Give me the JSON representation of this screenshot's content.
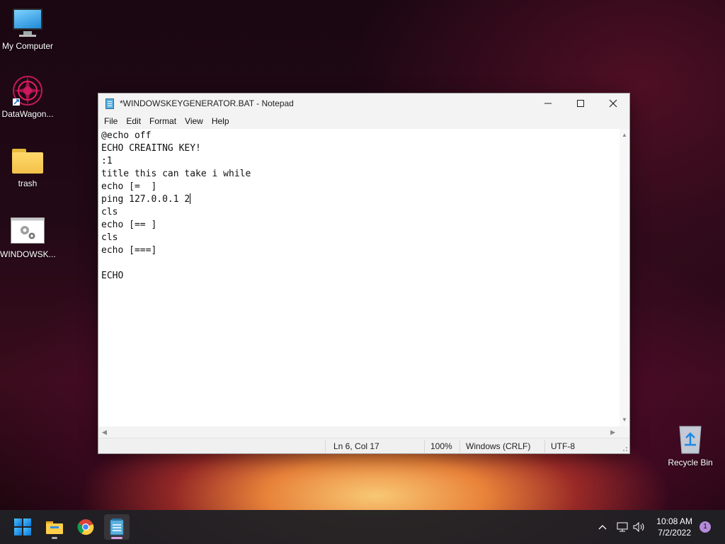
{
  "desktop": {
    "icons": [
      {
        "label": "My Computer",
        "icon": "computer-icon"
      },
      {
        "label": "DataWagon...",
        "icon": "datawagon-shortcut-icon"
      },
      {
        "label": "trash",
        "icon": "folder-icon"
      },
      {
        "label": "WINDOWSK...",
        "icon": "batch-file-icon"
      },
      {
        "label": "Recycle Bin",
        "icon": "recycle-bin-icon"
      }
    ]
  },
  "notepad": {
    "title": "*WINDOWSKEYGENERATOR.BAT - Notepad",
    "menu": [
      "File",
      "Edit",
      "Format",
      "View",
      "Help"
    ],
    "lines": [
      "@echo off",
      "ECHO CREAITNG KEY!",
      ":1",
      "title this can take i while",
      "echo [=  ]",
      "ping 127.0.0.1 2",
      "cls",
      "echo [== ]",
      "cls",
      "echo [===]",
      "",
      "ECHO"
    ],
    "status": {
      "position": "Ln 6, Col 17",
      "zoom": "100%",
      "line_endings": "Windows (CRLF)",
      "encoding": "UTF-8"
    }
  },
  "taskbar": {
    "apps": [
      "start-icon",
      "file-explorer-icon",
      "chrome-icon",
      "notepad-icon"
    ],
    "time": "10:08 AM",
    "date": "7/2/2022",
    "notification_count": "1"
  }
}
